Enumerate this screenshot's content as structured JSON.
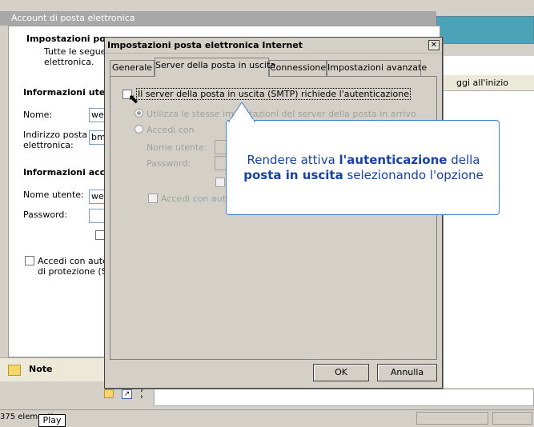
{
  "background_window": {
    "title": "Account di posta elettronica",
    "header_title": "Impostazioni pos",
    "header_desc_line1": "Tutte le seguen",
    "header_desc_line2": "elettronica.",
    "user_info_heading": "Informazioni uten",
    "name_label": "Nome:",
    "name_value": "we",
    "email_label_line1": "Indirizzo posta",
    "email_label_line2": "elettronica:",
    "email_value": "bm",
    "access_info_heading": "Informazioni acce",
    "username_label": "Nome utente:",
    "username_value": "we",
    "password_label": "Password:",
    "spa_label_line1": "Accedi con auten",
    "spa_label_line2": "di protezione (SP",
    "notes_label": "Note",
    "status_count": "375 elementi",
    "right_header": "ggi all'inizio"
  },
  "dialog": {
    "title": "Impostazioni posta elettronica Internet",
    "close_glyph": "✕",
    "tabs": [
      {
        "label": "Generale"
      },
      {
        "label": "Server della posta in uscita"
      },
      {
        "label": "Connessione"
      },
      {
        "label": "Impostazioni avanzate"
      }
    ],
    "smtp_auth_label": "Il server della posta in uscita (SMTP) richiede l'autenticazione",
    "use_same_label": "Utilizza le stesse impostazioni del server della posta in arrivo",
    "login_with_label": "Accedi con",
    "username_label": "Nome utente:",
    "password_label": "Password:",
    "spa_label": "Accedi con autenticazione",
    "ok_label": "OK",
    "cancel_label": "Annulla"
  },
  "callout": {
    "part1": "Rendere attiva ",
    "part2": "l'autenticazione",
    "part3": " della",
    "part4": "posta in uscita",
    "part5": " selezionando l'opzione"
  },
  "play_label": "Play",
  "colors": {
    "accent": "#4aa3b6",
    "callout_text": "#1a3fa6",
    "callout_border": "#3f7fd1"
  }
}
